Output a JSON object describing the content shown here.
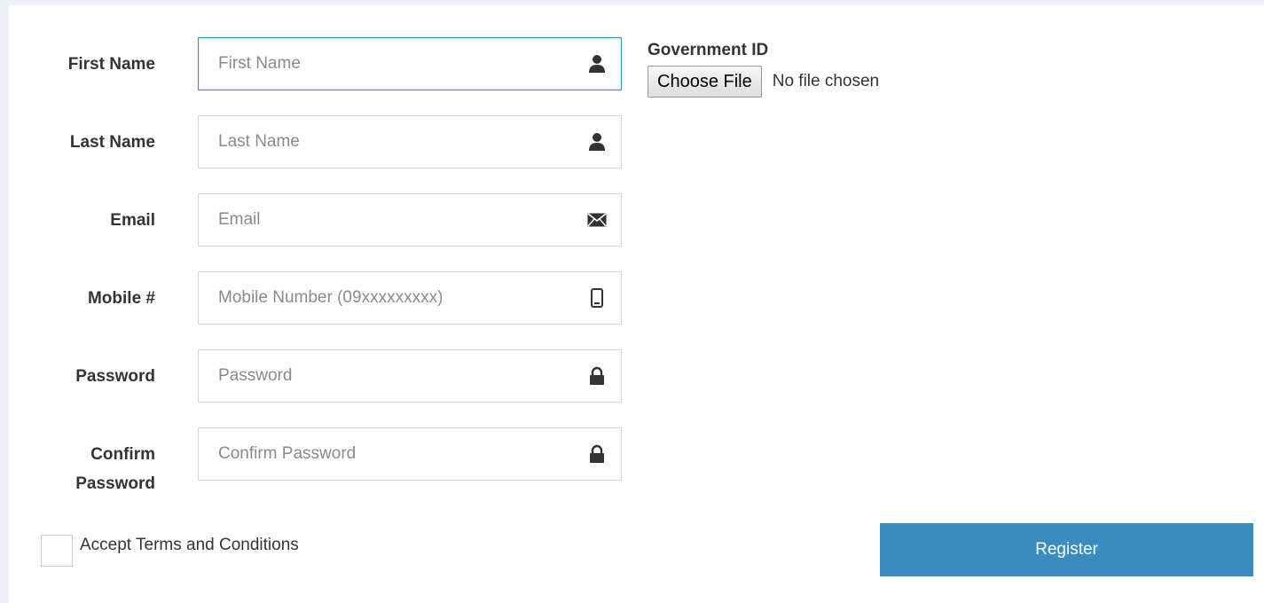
{
  "form": {
    "fields": [
      {
        "label": "First Name",
        "placeholder": "First Name",
        "icon": "user-icon"
      },
      {
        "label": "Last Name",
        "placeholder": "Last Name",
        "icon": "user-icon"
      },
      {
        "label": "Email",
        "placeholder": "Email",
        "icon": "envelope-icon"
      },
      {
        "label": "Mobile #",
        "placeholder": "Mobile Number (09xxxxxxxxx)",
        "icon": "mobile-phone-icon"
      },
      {
        "label": "Password",
        "placeholder": "Password",
        "icon": "lock-icon"
      },
      {
        "label_line1": "Confirm",
        "label_line2": "Password",
        "placeholder": "Confirm Password",
        "icon": "lock-icon"
      }
    ],
    "government_id": {
      "label": "Government ID",
      "button_label": "Choose File",
      "status": "No file chosen"
    },
    "terms": {
      "label": "Accept Terms and Conditions"
    },
    "submit_label": "Register"
  },
  "colors": {
    "accent": "#3a8cc0",
    "focus_border": "#3b8fc3",
    "background": "#edf1f7"
  }
}
